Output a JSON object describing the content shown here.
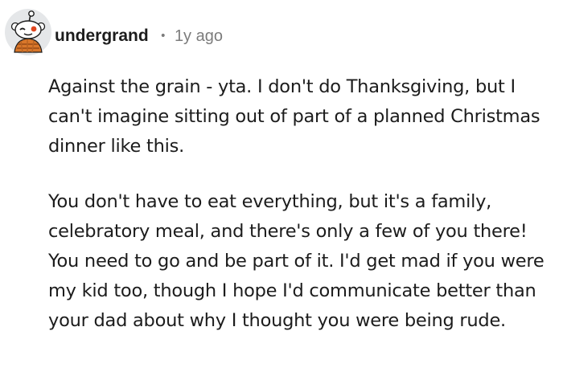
{
  "comment": {
    "author": "undergrand",
    "separator": "•",
    "age": "1y ago",
    "avatar_icon": "snoo-avatar-icon",
    "paragraphs": [
      "Against the grain - yta. I don't do Thanksgiving, but I can't imagine sitting out of part of a planned Christmas dinner like this.",
      "You don't have to eat everything, but it's a family, celebratory meal, and there's only a few of you there! You need to go and be part of it. I'd get mad if you were my kid too, though I hope I'd communicate better than your dad about why I thought you were being rude."
    ]
  },
  "colors": {
    "text": "#1c1c1c",
    "meta": "#7c7c7c",
    "background": "#ffffff"
  }
}
